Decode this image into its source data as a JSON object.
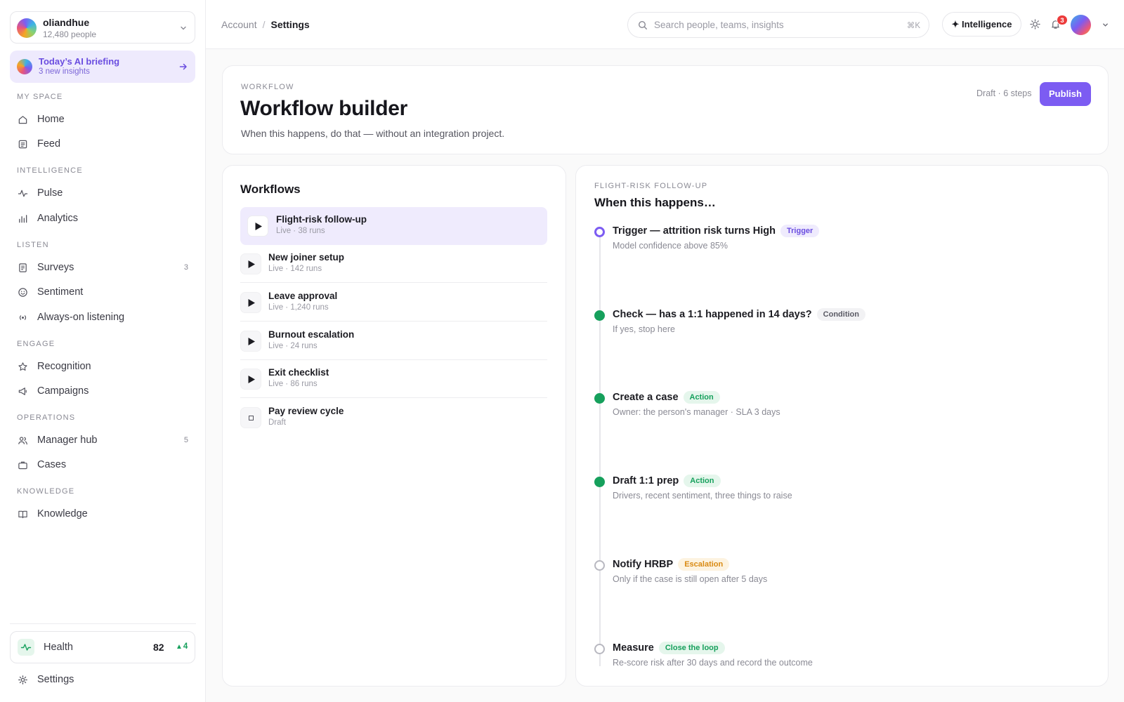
{
  "org": {
    "name": "oliandhue",
    "people": "12,480 people"
  },
  "briefing": {
    "title": "Today’s AI briefing",
    "subtitle": "3 new insights"
  },
  "sidebar": {
    "sections": [
      "MY SPACE",
      "INTELLIGENCE",
      "LISTEN",
      "ENGAGE",
      "OPERATIONS",
      "KNOWLEDGE"
    ],
    "items": [
      {
        "label": "Home",
        "icon": "home-icon"
      },
      {
        "label": "Feed",
        "icon": "feed-icon"
      },
      {
        "label": "Pulse",
        "icon": "pulse-icon"
      },
      {
        "label": "Analytics",
        "icon": "analytics-icon"
      },
      {
        "label": "Surveys",
        "icon": "surveys-icon",
        "count": "3"
      },
      {
        "label": "Sentiment",
        "icon": "smile-icon"
      },
      {
        "label": "Always-on listening",
        "icon": "broadcast-icon"
      },
      {
        "label": "Recognition",
        "icon": "star-icon"
      },
      {
        "label": "Campaigns",
        "icon": "megaphone-icon"
      },
      {
        "label": "Manager hub",
        "icon": "people-icon",
        "count": "5"
      },
      {
        "label": "Cases",
        "icon": "briefcase-icon"
      },
      {
        "label": "Knowledge",
        "icon": "book-icon"
      }
    ],
    "health": {
      "label": "Health",
      "score": "82",
      "delta": "4"
    },
    "settings": "Settings"
  },
  "breadcrumb": {
    "parent": "Account",
    "sep": "/",
    "current": "Settings"
  },
  "search": {
    "placeholder": "Search people, teams, insights",
    "shortcut": "⌘K"
  },
  "topbar": {
    "intelligence": "✦ Intelligence",
    "notifications": "3"
  },
  "header": {
    "eyebrow": "WORKFLOW",
    "title": "Workflow builder",
    "description": "When this happens, do that — without an integration project.",
    "meta": "Draft · 6 steps",
    "publish": "Publish"
  },
  "workflows": {
    "title": "Workflows",
    "items": [
      {
        "name": "Flight-risk follow-up",
        "status": "Live · 38 runs",
        "state": "live",
        "selected": true
      },
      {
        "name": "New joiner setup",
        "status": "Live · 142 runs",
        "state": "live"
      },
      {
        "name": "Leave approval",
        "status": "Live · 1,240 runs",
        "state": "live"
      },
      {
        "name": "Burnout escalation",
        "status": "Live · 24 runs",
        "state": "live"
      },
      {
        "name": "Exit checklist",
        "status": "Live · 86 runs",
        "state": "live"
      },
      {
        "name": "Pay review cycle",
        "status": "Draft",
        "state": "draft"
      }
    ]
  },
  "steps": {
    "eyebrow": "FLIGHT-RISK FOLLOW-UP",
    "title": "When this happens…",
    "items": [
      {
        "title": "Trigger — attrition risk turns High",
        "tag": "Trigger",
        "desc": "Model confidence above 85%",
        "status": "trigger",
        "tag_bg": "#efebfd",
        "tag_fg": "#6a4de0"
      },
      {
        "title": "Check — has a 1:1 happened in 14 days?",
        "tag": "Condition",
        "desc": "If yes, stop here",
        "status": "done",
        "tag_bg": "#f2f2f4",
        "tag_fg": "#5a5a64"
      },
      {
        "title": "Create a case",
        "tag": "Action",
        "desc": "Owner: the person's manager · SLA 3 days",
        "status": "done",
        "tag_bg": "#e5f6ec",
        "tag_fg": "#16a05c"
      },
      {
        "title": "Draft 1:1 prep",
        "tag": "Action",
        "desc": "Drivers, recent sentiment, three things to raise",
        "status": "done",
        "tag_bg": "#e5f6ec",
        "tag_fg": "#16a05c"
      },
      {
        "title": "Notify HRBP",
        "tag": "Escalation",
        "desc": "Only if the case is still open after 5 days",
        "status": "pending",
        "tag_bg": "#fdf3e0",
        "tag_fg": "#d98a12"
      },
      {
        "title": "Measure",
        "tag": "Close the loop",
        "desc": "Re-score risk after 30 days and record the outcome",
        "status": "pending",
        "tag_bg": "#e5f6ec",
        "tag_fg": "#16a05c"
      }
    ]
  },
  "colors": {
    "accent": "#7c5cf2",
    "success": "#16a05c",
    "warning": "#d98a12",
    "danger": "#ec3b3b"
  }
}
